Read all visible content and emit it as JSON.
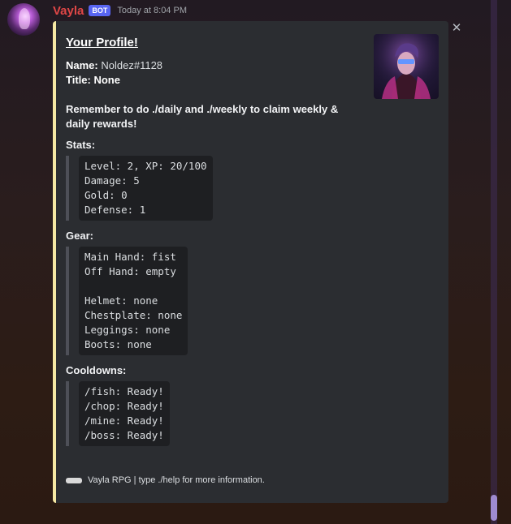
{
  "message": {
    "username": "Vayla",
    "bot_tag": "BOT",
    "timestamp": "Today at 8:04 PM",
    "username_color": "#e04747",
    "embed_accent": "#f5e8a3"
  },
  "embed": {
    "title": "Your Profile!",
    "name_label": "Name:",
    "name_value": "Noldez#1128",
    "title_label": "Title:",
    "title_value": "None",
    "reminder": "Remember to do ./daily and ./weekly to claim weekly & daily rewards!",
    "stats_label": "Stats:",
    "stats_text": "Level: 2, XP: 20/100\nDamage: 5\nGold: 0\nDefense: 1",
    "gear_label": "Gear:",
    "gear_text": "Main Hand: fist\nOff Hand: empty\n\nHelmet: none\nChestplate: none\nLeggings: none\nBoots: none",
    "cooldowns_label": "Cooldowns:",
    "cooldowns_text": "/fish: Ready!\n/chop: Ready!\n/mine: Ready!\n/boss: Ready!",
    "footer": "Vayla RPG | type ./help for more information."
  },
  "icons": {
    "close": "close-icon",
    "thumbnail": "profile-thumbnail",
    "avatar": "bot-avatar"
  }
}
